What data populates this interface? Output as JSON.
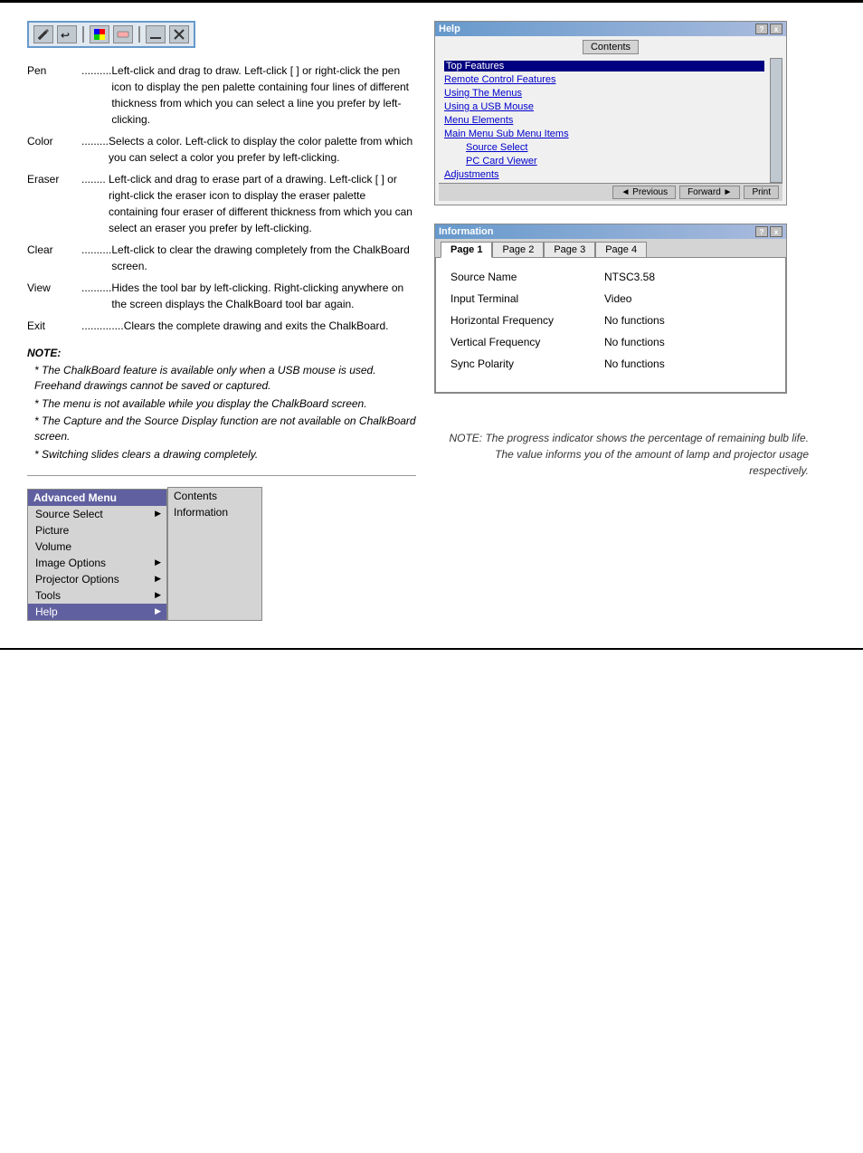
{
  "toolbar": {
    "icons": [
      {
        "name": "pen-icon",
        "symbol": "✏"
      },
      {
        "name": "move-icon",
        "symbol": "✥"
      },
      {
        "name": "color-icon",
        "symbol": "■"
      },
      {
        "name": "eraser-icon",
        "symbol": "◻"
      },
      {
        "name": "clear-icon",
        "symbol": "—"
      },
      {
        "name": "close-icon",
        "symbol": "✕"
      }
    ]
  },
  "descriptions": [
    {
      "term": "Pen",
      "dots": " ..........",
      "def": "Left-click and drag to draw. Left-click [     ] or right-click the pen icon to display the pen palette containing four lines of different thickness from which you can select a line you prefer by left-clicking."
    },
    {
      "term": "Color",
      "dots": " .........",
      "def": "Selects a color. Left-click to display the color palette from which you can select a color you prefer by left-clicking."
    },
    {
      "term": "Eraser",
      "dots": " ........",
      "def": "Left-click and drag to erase part of a drawing. Left-click [     ] or right-click the eraser icon to display the eraser palette containing four eraser of different thickness from which you can select an eraser you prefer by left-clicking."
    },
    {
      "term": "Clear",
      "dots": " ..........",
      "def": "Left-click to clear the drawing completely from the ChalkBoard screen."
    },
    {
      "term": "View",
      "dots": " ..........",
      "def": "Hides the tool bar by left-clicking. Right-clicking anywhere on the screen displays the ChalkBoard tool bar again."
    },
    {
      "term": "Exit",
      "dots": " ..............",
      "def": "Clears the complete drawing and exits the ChalkBoard."
    }
  ],
  "note": {
    "title": "NOTE:",
    "items": [
      "The ChalkBoard feature is available only when a USB mouse is used. Freehand drawings cannot be saved or captured.",
      "The menu is not available while you display the ChalkBoard screen.",
      "The Capture and the Source Display function are not available on ChalkBoard screen.",
      "Switching slides clears a drawing completely."
    ]
  },
  "advanced_menu": {
    "title": "Advanced Menu",
    "items": [
      {
        "label": "Source Select",
        "has_arrow": true
      },
      {
        "label": "Picture",
        "has_arrow": false
      },
      {
        "label": "Volume",
        "has_arrow": false
      },
      {
        "label": "Image Options",
        "has_arrow": true
      },
      {
        "label": "Projector Options",
        "has_arrow": true
      },
      {
        "label": "Tools",
        "has_arrow": true
      },
      {
        "label": "Help",
        "has_arrow": false,
        "selected": true
      }
    ],
    "submenu": [
      {
        "label": "Contents"
      },
      {
        "label": "Information"
      }
    ]
  },
  "help_window": {
    "title": "Help",
    "close_btn": "x",
    "tab": "Contents",
    "links": [
      {
        "label": "Top Features",
        "active": true
      },
      {
        "label": "Remote Control Features",
        "active": false
      },
      {
        "label": "Using The Menus",
        "active": false
      },
      {
        "label": "Using a USB Mouse",
        "active": false
      },
      {
        "label": "Menu Elements",
        "active": false
      },
      {
        "label": "Main Menu Sub Menu Items",
        "active": false
      },
      {
        "label": "Source Select",
        "indented": true
      },
      {
        "label": "PC Card Viewer",
        "indented": true
      },
      {
        "label": "Adjustments",
        "indented": false
      }
    ],
    "nav_buttons": [
      {
        "label": "◄ Previous"
      },
      {
        "label": "Forward ►"
      },
      {
        "label": "Print"
      }
    ]
  },
  "info_window": {
    "title": "Information",
    "question_btn": "?",
    "close_btn": "x",
    "tabs": [
      {
        "label": "Page 1",
        "active": true
      },
      {
        "label": "Page 2",
        "active": false
      },
      {
        "label": "Page 3",
        "active": false
      },
      {
        "label": "Page 4",
        "active": false
      }
    ],
    "rows": [
      {
        "label": "Source Name",
        "value": "NTSC3.58"
      },
      {
        "label": "Input Terminal",
        "value": "Video"
      },
      {
        "label": "Horizontal Frequency",
        "value": "No functions"
      },
      {
        "label": "Vertical Frequency",
        "value": "No functions"
      },
      {
        "label": "Sync Polarity",
        "value": "No functions"
      }
    ]
  },
  "bottom_note": {
    "line1": "NOTE: The progress indicator shows the percentage of remaining bulb life.",
    "line2": "The value informs you of the amount of lamp and projector usage respectively."
  }
}
